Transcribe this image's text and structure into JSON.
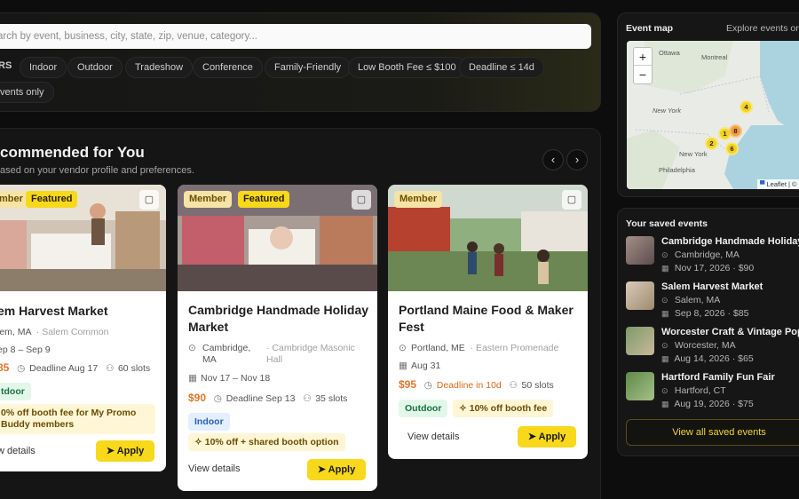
{
  "search": {
    "placeholder": "arch by event, business, city, state, zip, venue, category...",
    "filters_label": "RS",
    "chips": [
      "Indoor",
      "Outdoor",
      "Tradeshow",
      "Conference",
      "Family-Friendly",
      "Low Booth Fee ≤ $100",
      "Deadline ≤ 14d",
      "vents only"
    ]
  },
  "recommended": {
    "title": "commended for You",
    "subtitle": "ased on your vendor profile and preferences.",
    "prev_icon": "chevron-left-icon",
    "next_icon": "chevron-right-icon"
  },
  "cards": [
    {
      "badges": [
        "mber",
        "Featured"
      ],
      "title": "em Harvest Market",
      "location": "lem, MA",
      "venue": "· Salem Common",
      "dates": "ep 8 – Sep 9",
      "price": "85",
      "deadline": "Deadline Aug 17",
      "slots": "60 slots",
      "tags": [
        "tdoor"
      ],
      "promo": "0% off booth fee for My Promo Buddy members",
      "view": "w details",
      "apply": "Apply"
    },
    {
      "badges": [
        "Member",
        "Featured"
      ],
      "title": "Cambridge Handmade Holiday Market",
      "location": "Cambridge, MA",
      "venue": "· Cambridge Masonic Hall",
      "dates": "Nov 17 – Nov 18",
      "price": "$90",
      "deadline": "Deadline Sep 13",
      "slots": "35 slots",
      "tags": [
        "Indoor"
      ],
      "promo": "10% off + shared booth option",
      "view": "View details",
      "apply": "Apply"
    },
    {
      "badges": [
        "Member"
      ],
      "title": "Portland Maine Food & Maker Fest",
      "location": "Portland, ME",
      "venue": "· Eastern Promenade",
      "dates": "Aug 31",
      "price": "$95",
      "deadline": "Deadline in 10d",
      "slots": "50 slots",
      "tags": [
        "Outdoor"
      ],
      "promo": "10% off booth fee",
      "view": "View details",
      "apply": "Apply"
    }
  ],
  "map": {
    "title": "Event map",
    "explore": "Explore events on",
    "zoom_in": "+",
    "zoom_out": "−",
    "labels": {
      "ottawa": "Ottawa",
      "montreal": "Montreal",
      "new_york_state": "New York",
      "new_york_city": "New York",
      "philadelphia": "Philadelphia"
    },
    "markers": [
      "4",
      "1",
      "8",
      "2",
      "6"
    ],
    "attribution": "Leaflet | © OpenS"
  },
  "saved": {
    "title": "Your saved events",
    "items": [
      {
        "name": "Cambridge Handmade Holiday M",
        "location": "Cambridge, MA",
        "date": "Nov 17, 2026 · $90"
      },
      {
        "name": "Salem Harvest Market",
        "location": "Salem, MA",
        "date": "Sep 8, 2026 · $85"
      },
      {
        "name": "Worcester Craft & Vintage Pop-U",
        "location": "Worcester, MA",
        "date": "Aug 14, 2026 · $65"
      },
      {
        "name": "Hartford Family Fun Fair",
        "location": "Hartford, CT",
        "date": "Aug 19, 2026 · $75"
      }
    ],
    "view_all": "View all saved events"
  }
}
